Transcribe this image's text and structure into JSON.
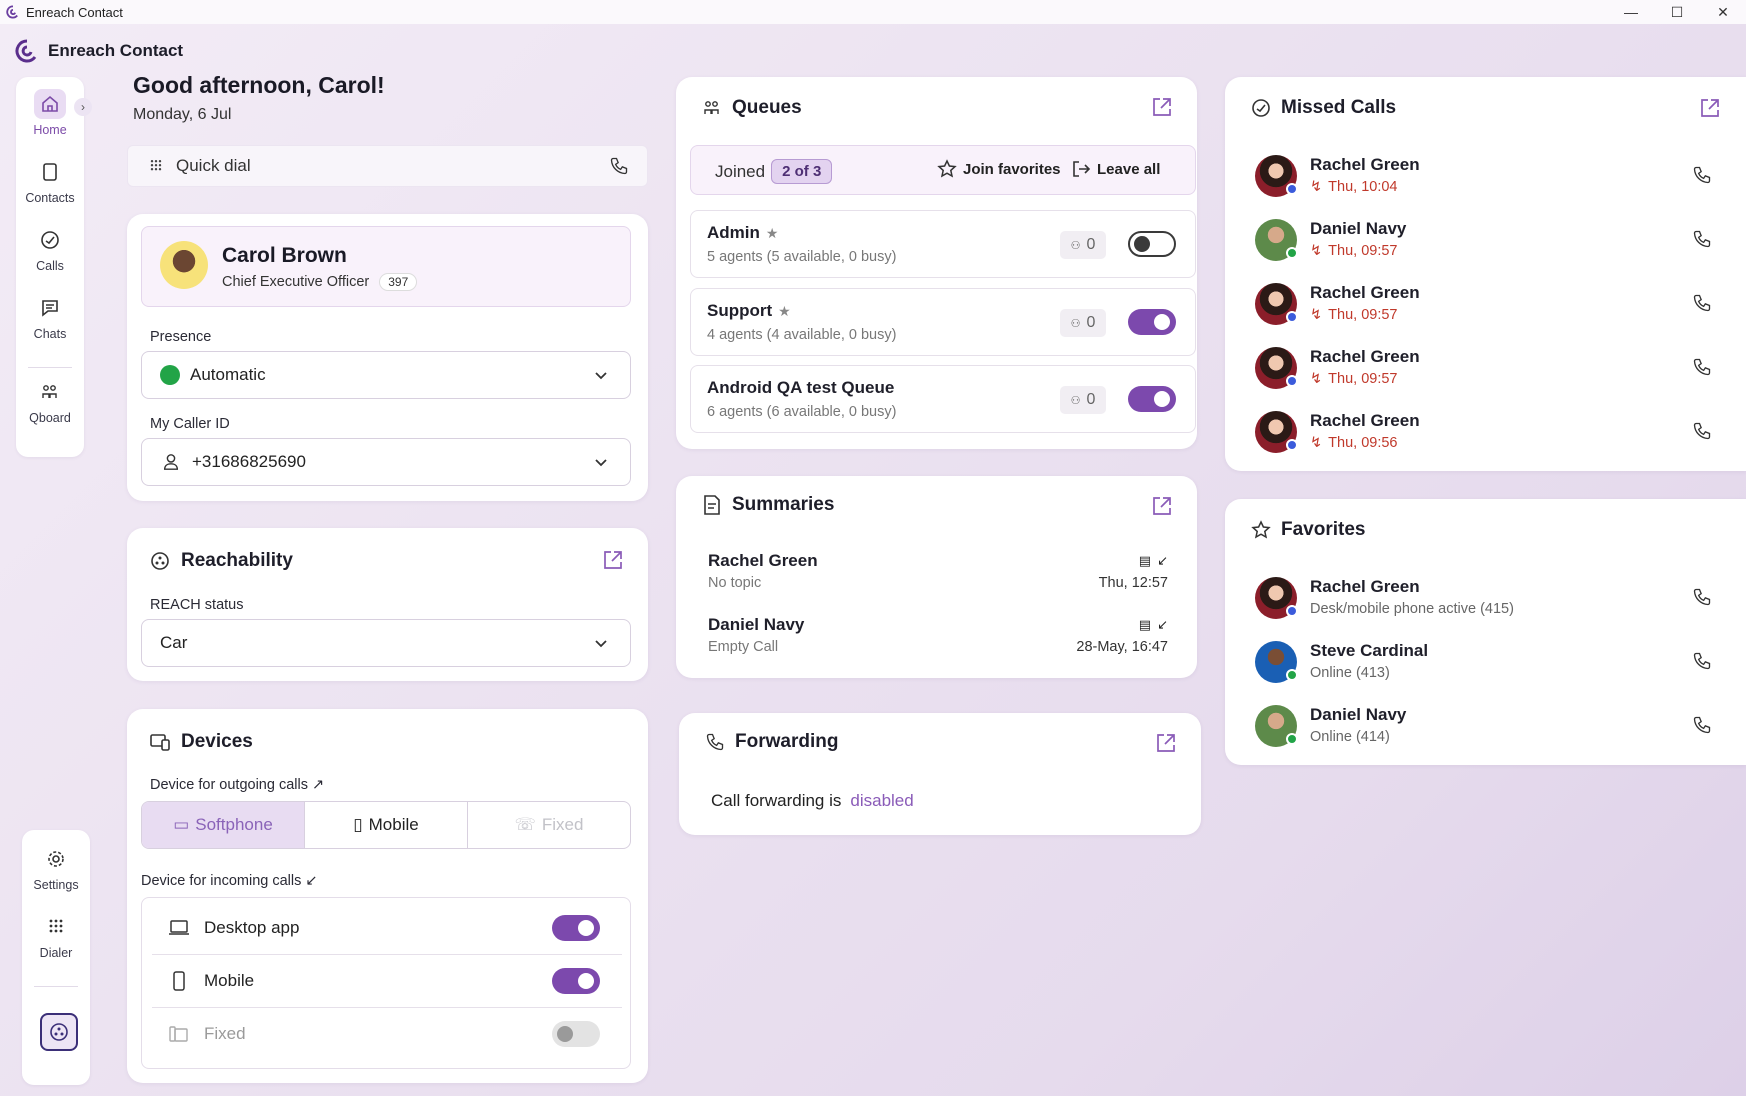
{
  "window": {
    "title": "Enreach Contact",
    "controls": [
      "—",
      "☐",
      "✕"
    ]
  },
  "brand": {
    "name": "Enreach Contact"
  },
  "nav": {
    "items": [
      {
        "label": "Home",
        "icon": "home-icon"
      },
      {
        "label": "Contacts",
        "icon": "contacts-icon"
      },
      {
        "label": "Calls",
        "icon": "calls-icon"
      },
      {
        "label": "Chats",
        "icon": "chats-icon"
      },
      {
        "label": "Qboard",
        "icon": "qboard-icon"
      }
    ],
    "bottom": [
      {
        "label": "Settings",
        "icon": "gear-icon"
      },
      {
        "label": "Dialer",
        "icon": "dialpad-icon"
      }
    ]
  },
  "greeting": {
    "title": "Good afternoon, Carol!",
    "date": "Monday, 6 Jul"
  },
  "quick_dial": {
    "placeholder": "Quick dial"
  },
  "profile": {
    "name": "Carol Brown",
    "role": "Chief Executive Officer",
    "extension": "397",
    "presence_label": "Presence",
    "presence_value": "Automatic",
    "caller_id_label": "My Caller ID",
    "caller_id_value": "+31686825690"
  },
  "reachability": {
    "title": "Reachability",
    "status_label": "REACH status",
    "status_value": "Car"
  },
  "devices": {
    "title": "Devices",
    "outgoing_label": "Device for outgoing calls ↗",
    "outgoing_options": [
      "Softphone",
      "Mobile",
      "Fixed"
    ],
    "outgoing_selected": "Softphone",
    "incoming_label": "Device for incoming calls ↙",
    "incoming": [
      {
        "label": "Desktop app",
        "state": "on"
      },
      {
        "label": "Mobile",
        "state": "on"
      },
      {
        "label": "Fixed",
        "state": "disabled"
      }
    ]
  },
  "queues": {
    "title": "Queues",
    "joined_label": "Joined",
    "joined_badge": "2 of 3",
    "join_favorites": "Join favorites",
    "leave_all": "Leave all",
    "items": [
      {
        "name": "Admin",
        "sub": "5 agents (5 available, 0 busy)",
        "count": "0",
        "joined": false
      },
      {
        "name": "Support",
        "sub": "4 agents (4 available, 0 busy)",
        "count": "0",
        "joined": true
      },
      {
        "name": "Android QA test Queue",
        "sub": "6 agents (6 available, 0 busy)",
        "count": "0",
        "joined": true
      }
    ]
  },
  "summaries": {
    "title": "Summaries",
    "items": [
      {
        "name": "Rachel Green",
        "topic": "No topic",
        "time": "Thu, 12:57"
      },
      {
        "name": "Daniel Navy",
        "topic": "Empty Call",
        "time": "28-May, 16:47"
      }
    ]
  },
  "forwarding": {
    "title": "Forwarding",
    "text": "Call forwarding is",
    "status": "disabled"
  },
  "missed_calls": {
    "title": "Missed Calls",
    "items": [
      {
        "name": "Rachel Green",
        "time": "Thu, 10:04",
        "presence": "#3b5bdb"
      },
      {
        "name": "Daniel Navy",
        "time": "Thu, 09:57",
        "presence": "#22a447"
      },
      {
        "name": "Rachel Green",
        "time": "Thu, 09:57",
        "presence": "#3b5bdb"
      },
      {
        "name": "Rachel Green",
        "time": "Thu, 09:57",
        "presence": "#3b5bdb"
      },
      {
        "name": "Rachel Green",
        "time": "Thu, 09:56",
        "presence": "#3b5bdb"
      }
    ]
  },
  "favorites": {
    "title": "Favorites",
    "items": [
      {
        "name": "Rachel Green",
        "status": "Desk/mobile phone active (415)",
        "presence": "#3b5bdb"
      },
      {
        "name": "Steve Cardinal",
        "status": "Online (413)",
        "presence": "#22a447"
      },
      {
        "name": "Daniel Navy",
        "status": "Online (414)",
        "presence": "#22a447"
      }
    ]
  },
  "colors": {
    "accent": "#7c49ad",
    "missed": "#c0392b",
    "online": "#22a447",
    "busy": "#3b5bdb"
  }
}
